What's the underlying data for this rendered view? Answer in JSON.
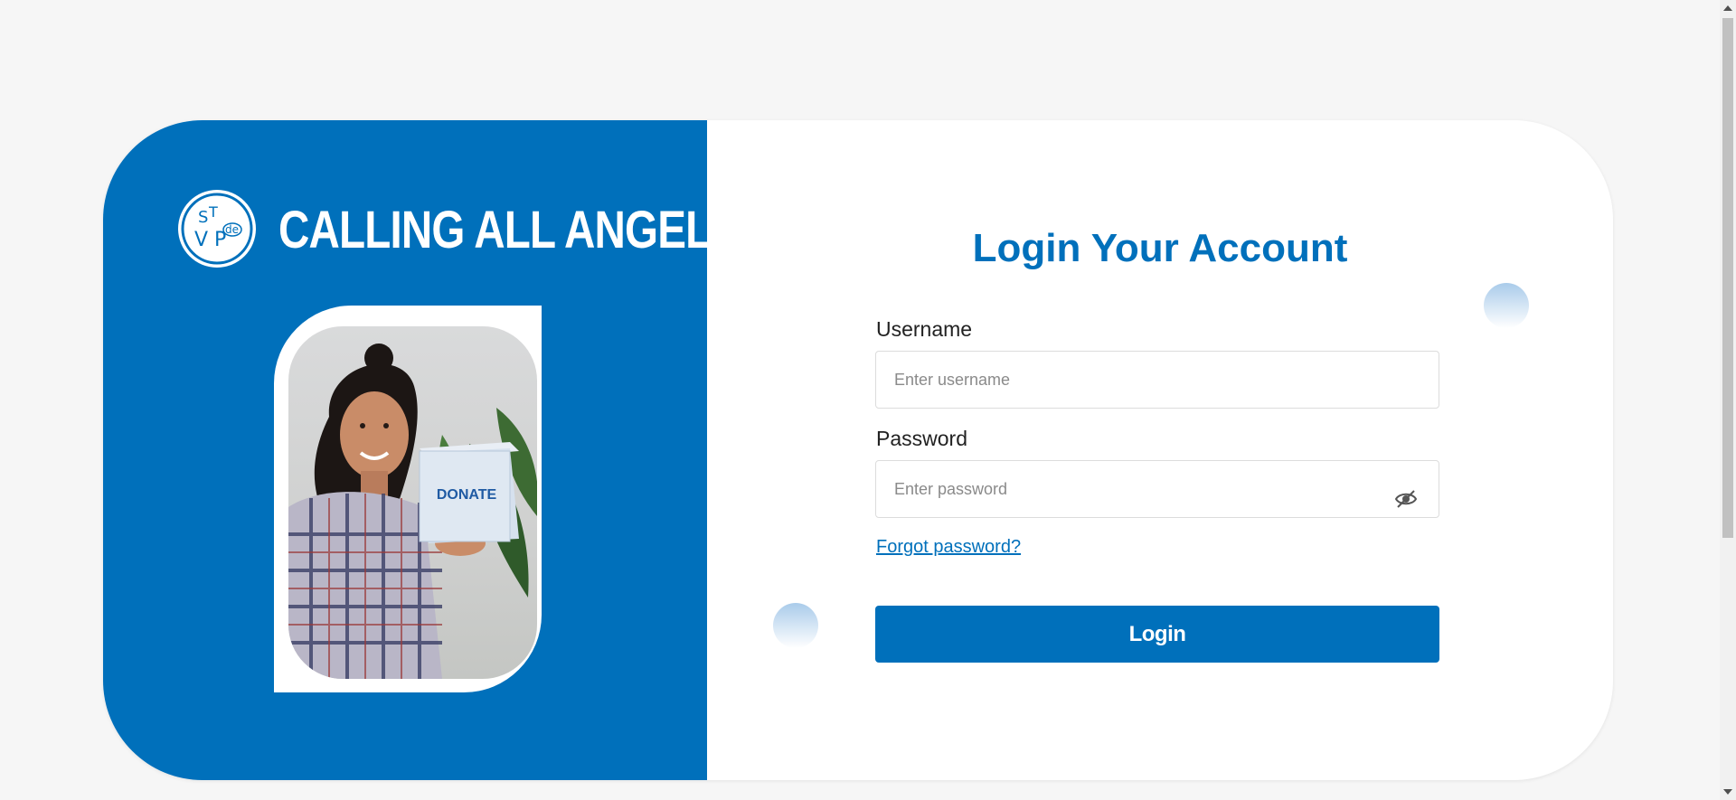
{
  "brand": {
    "name": "CALLING ALL ANGELS",
    "logo_icon": "svdp-logo-icon",
    "primary_color": "#0070bb"
  },
  "hero": {
    "image_description_icon": "donate-box-photo",
    "box_label": "DONATE"
  },
  "login": {
    "title": "Login Your Account",
    "username_label": "Username",
    "username_placeholder": "Enter username",
    "username_value": "",
    "password_label": "Password",
    "password_placeholder": "Enter password",
    "password_value": "",
    "toggle_icon": "eye-slash-icon",
    "forgot_label": "Forgot password?",
    "submit_label": "Login"
  }
}
